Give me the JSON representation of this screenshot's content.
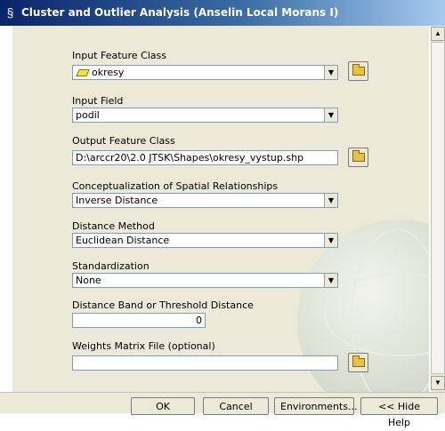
{
  "window": {
    "title": "Cluster and Outlier Analysis (Anselin Local Morans I)",
    "icon": "script-tool-icon"
  },
  "form": {
    "input_feature_class": {
      "label": "Input Feature Class",
      "value": "okresy"
    },
    "input_field": {
      "label": "Input Field",
      "value": "podil"
    },
    "output_feature_class": {
      "label": "Output Feature Class",
      "value": "D:\\arccr20\\2.0 JTSK\\Shapes\\okresy_vystup.shp"
    },
    "conceptualization": {
      "label": "Conceptualization of Spatial Relationships",
      "value": "Inverse Distance"
    },
    "distance_method": {
      "label": "Distance Method",
      "value": "Euclidean Distance"
    },
    "standardization": {
      "label": "Standardization",
      "value": "None"
    },
    "distance_band": {
      "label": "Distance Band or Threshold Distance",
      "value": "0"
    },
    "weights_matrix": {
      "label": "Weights Matrix File (optional)",
      "value": ""
    }
  },
  "buttons": {
    "ok": "OK",
    "cancel": "Cancel",
    "environments": "Environments...",
    "hide_help": "<< Hide Help"
  },
  "colors": {
    "title_start": "#0a246a",
    "title_end": "#a6caf0",
    "panel": "#ece9d8"
  }
}
